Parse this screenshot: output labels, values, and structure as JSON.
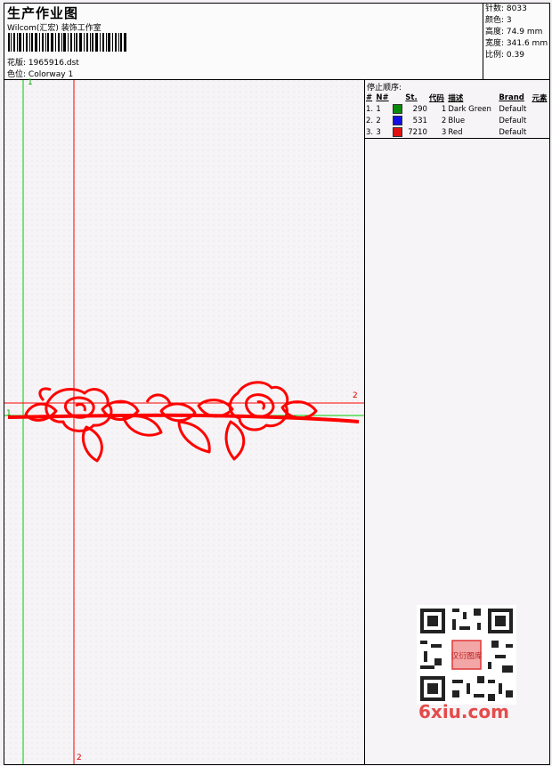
{
  "header": {
    "title": "生产作业图",
    "subtitle": "Wilcom(汇宏) 装饰工作室",
    "design_label": "花版:",
    "design_value": "1965916.dst",
    "colorway_label": "色位:",
    "colorway_value": "Colorway 1"
  },
  "specs": [
    {
      "label": "针数:",
      "value": "8033"
    },
    {
      "label": "颜色:",
      "value": "3"
    },
    {
      "label": "高度:",
      "value": "74.9 mm"
    },
    {
      "label": "宽度:",
      "value": "341.6 mm"
    },
    {
      "label": "比例:",
      "value": "0.39"
    }
  ],
  "panel": {
    "title": "停止顺序:",
    "columns": [
      "#",
      "N#",
      "St.",
      "代码",
      "描述",
      "Brand",
      "元素"
    ],
    "rows": [
      {
        "num": "1.",
        "n": "1",
        "swatch": "#0a8a0a",
        "st": "290",
        "code": "1",
        "desc": "Dark Green",
        "brand": "Default"
      },
      {
        "num": "2.",
        "n": "2",
        "swatch": "#1010e0",
        "st": "531",
        "code": "2",
        "desc": "Blue",
        "brand": "Default"
      },
      {
        "num": "3.",
        "n": "3",
        "swatch": "#e01010",
        "st": "7210",
        "code": "3",
        "desc": "Red",
        "brand": "Default"
      }
    ]
  },
  "guides": {
    "green_top": "1",
    "green_left": "1",
    "red_right": "2",
    "red_bottom": "2"
  },
  "watermark": {
    "text": "6xiu.com",
    "stamp": "汉衍图库"
  },
  "colors": {
    "embroidery": "#ff0000",
    "guide_green": "#00cc00",
    "guide_red": "#ff0000"
  }
}
